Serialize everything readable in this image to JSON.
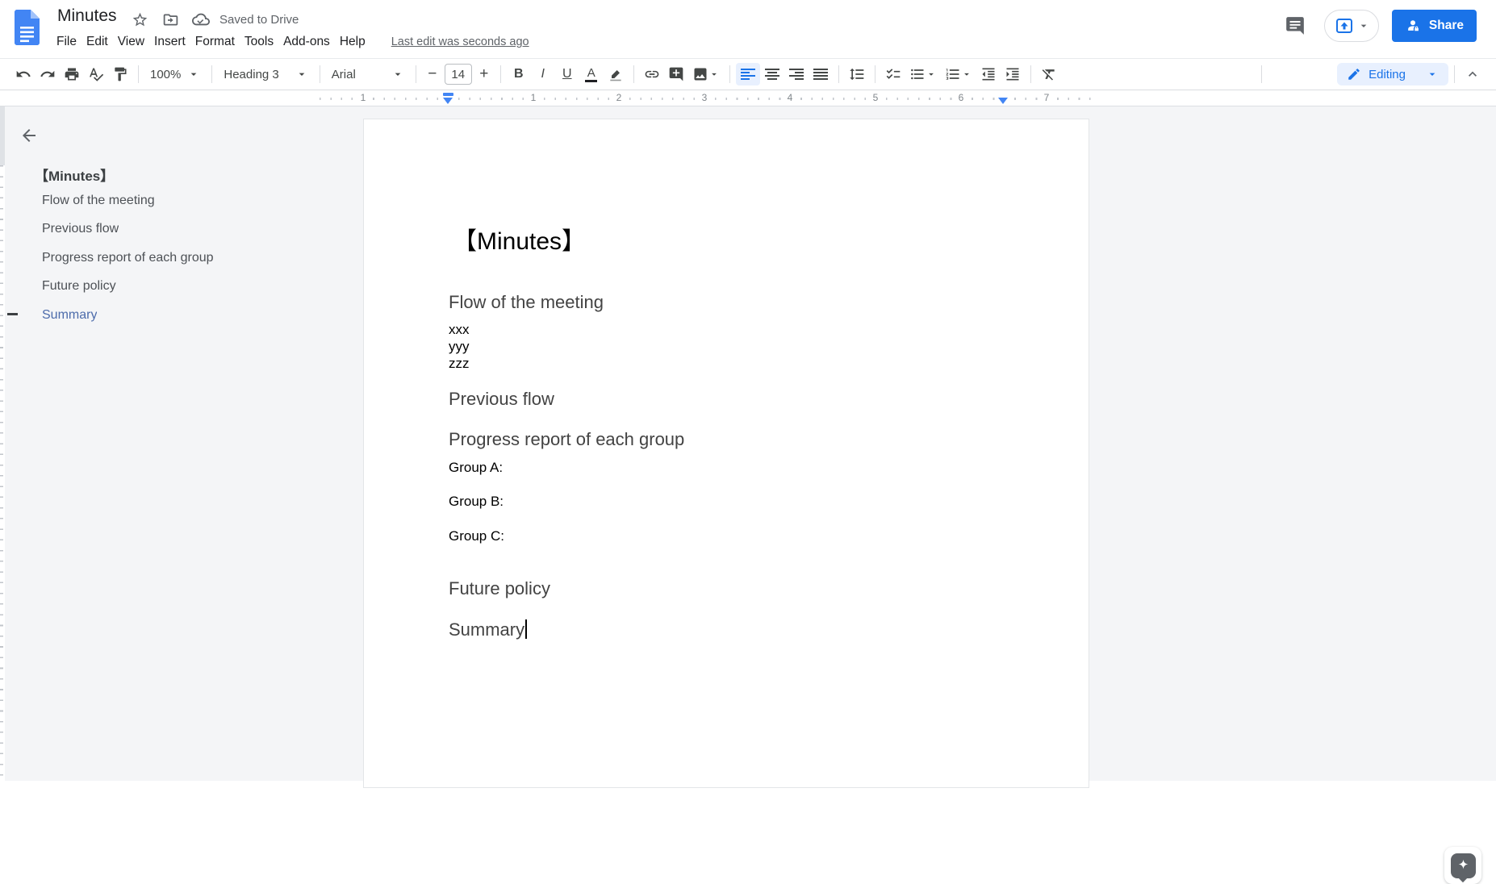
{
  "header": {
    "doc_title": "Minutes",
    "saved_status": "Saved to Drive",
    "last_edit": "Last edit was seconds ago",
    "share_label": "Share",
    "menu": {
      "items": [
        {
          "label": "File"
        },
        {
          "label": "Edit"
        },
        {
          "label": "View"
        },
        {
          "label": "Insert"
        },
        {
          "label": "Format"
        },
        {
          "label": "Tools"
        },
        {
          "label": "Add-ons"
        },
        {
          "label": "Help"
        }
      ]
    }
  },
  "toolbar": {
    "zoom_value": "100%",
    "style_value": "Heading 3",
    "font_value": "Arial",
    "font_size_value": "14",
    "decrease_label": "−",
    "increase_label": "+",
    "bold_label": "B",
    "italic_label": "I",
    "underline_label": "U",
    "text_color_label": "A",
    "mode_label": "Editing"
  },
  "ruler": {
    "numbers": [
      "1",
      "1",
      "2",
      "3",
      "4",
      "5",
      "6",
      "7"
    ]
  },
  "outline": {
    "heading": "【Minutes】",
    "items": [
      {
        "label": "Flow of the meeting"
      },
      {
        "label": "Previous flow"
      },
      {
        "label": "Progress report of each group"
      },
      {
        "label": "Future policy"
      },
      {
        "label": "Summary"
      }
    ]
  },
  "document": {
    "title": "【Minutes】",
    "heading_flow": "Flow of the meeting",
    "flow_lines": [
      "xxx",
      "yyy",
      "zzz"
    ],
    "heading_previous": "Previous flow",
    "heading_progress": "Progress report of each group",
    "groups": [
      "Group A:",
      "Group B:",
      "Group C:"
    ],
    "heading_future": "Future policy",
    "heading_summary": "Summary"
  },
  "colors": {
    "accent_blue": "#1a73e8",
    "editing_pill_bg": "#e8f0fe",
    "ruler_marker_blue": "#4285f4",
    "outline_active_blue": "#4d6cab",
    "heading_text_gray": "#434343",
    "canvas_gray": "#f4f5f7"
  }
}
